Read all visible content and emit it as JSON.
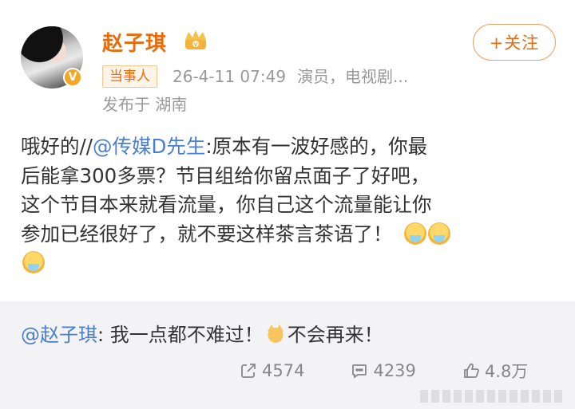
{
  "post": {
    "author": "赵子琪",
    "follow_label": "+关注",
    "role_badge": "当事人",
    "timestamp": "26-4-11 07:49",
    "bio": "演员，电视剧...",
    "location": "发布于 湖南",
    "verified_badge": "V",
    "content": {
      "lines": [
        {
          "before": "哦好的//",
          "mention": "@传媒D先生",
          "after": ":原本有一波好感的，你最"
        },
        {
          "text": "后能拿300多票？节目组给你留点面子了好吧，"
        },
        {
          "text": "这个节目本来就看流量，你自己这个流量能让你"
        },
        {
          "text": "参加已经很好了，就不要这样茶言茶语了！"
        }
      ],
      "emoji_name": "crying-emoji"
    }
  },
  "repost": {
    "mention": "@赵子琪",
    "text_before": ": 我一点都不难过！",
    "emoji_name": "cat-emoji",
    "text_after": "不会再来！"
  },
  "actions": {
    "share_count": "4574",
    "comment_count": "4239",
    "like_count": "4.8万"
  },
  "colors": {
    "accent": "#e86b0c",
    "mention": "#4a7fcf",
    "meta": "#999999",
    "repost_bg": "#f3f3f5"
  }
}
